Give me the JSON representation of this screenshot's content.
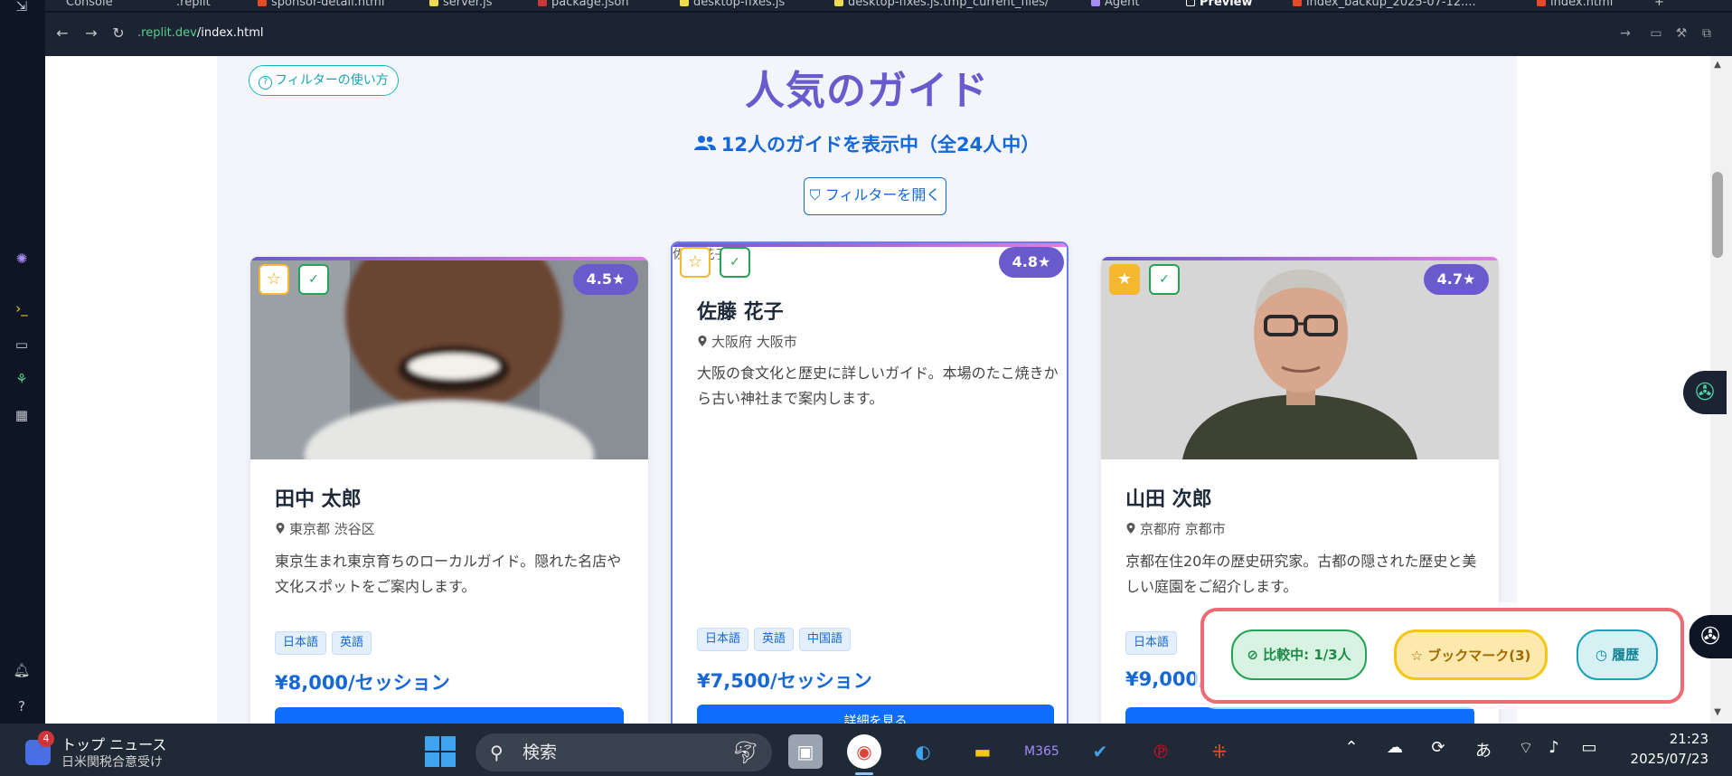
{
  "tabs": [
    {
      "label": "Console",
      "color": "#c2c8cc"
    },
    {
      "label": ".replit",
      "color": "#c2c8cc"
    },
    {
      "label": "sponsor-detail.html",
      "color": "#e34c26"
    },
    {
      "label": "server.js",
      "color": "#f0db4f"
    },
    {
      "label": "package.json",
      "color": "#cb3837"
    },
    {
      "label": "desktop-fixes.js",
      "color": "#f0db4f"
    },
    {
      "label": "desktop-fixes.js.tmp_current_files/",
      "color": "#f0db4f"
    },
    {
      "label": "Agent",
      "color": "#a78bfa"
    },
    {
      "label": "Preview",
      "color": "#ffffff"
    },
    {
      "label": "index_backup_2025-07-12....",
      "color": "#e34c26"
    },
    {
      "label": "index.html",
      "color": "#e34c26"
    }
  ],
  "browser": {
    "url_domain": ".replit.dev",
    "url_path": "/index.html"
  },
  "page": {
    "filter_help": "フィルターの使い方",
    "title": "人気のガイド",
    "count_text": "12人のガイドを表示中（全24人中）",
    "open_filter": "フィルターを開く"
  },
  "cards": [
    {
      "name": "田中 太郎",
      "location": "東京都 渋谷区",
      "description": "東京生まれ東京育ちのローカルガイド。隠れた名店や文化スポットをご案内します。",
      "tags": [
        "日本語",
        "英語"
      ],
      "price": "¥8,000/セッション",
      "rating": "4.5★",
      "favorite": false
    },
    {
      "name": "佐藤 花子",
      "image_alt": "佐藤 花子",
      "location": "大阪府 大阪市",
      "description": "大阪の食文化と歴史に詳しいガイド。本場のたこ焼きから古い神社まで案内します。",
      "tags": [
        "日本語",
        "英語",
        "中国語"
      ],
      "price": "¥7,500/セッション",
      "rating": "4.8★",
      "favorite": false,
      "detail_button": "詳細を見る"
    },
    {
      "name": "山田 次郎",
      "location": "京都府 京都市",
      "description": "京都在住20年の歴史研究家。古都の隠された歴史と美しい庭園をご紹介します。",
      "tags": [
        "日本語"
      ],
      "price": "¥9,000/",
      "rating": "4.7★",
      "favorite": true
    }
  ],
  "float_panel": {
    "compare": "比較中: 1/3人",
    "bookmark": "ブックマーク(3)",
    "history": "履歴"
  },
  "taskbar": {
    "news_badge": "4",
    "news_title": "トップ ニュース",
    "news_sub": "日米関税合意受け",
    "search_placeholder": "検索",
    "ime": "あ",
    "time": "21:23",
    "date": "2025/07/23"
  }
}
